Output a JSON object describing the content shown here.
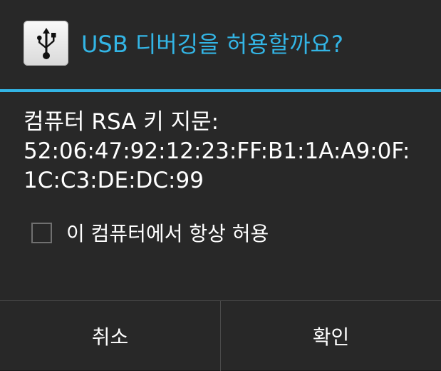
{
  "dialog": {
    "title": "USB 디버깅을 허용할까요?",
    "icon": "usb-icon",
    "accent_color": "#33b5e5",
    "message_line1": "컴퓨터 RSA 키 지문:",
    "message_line2": "52:06:47:92:12:23:FF:B1:1A:A9:0F:",
    "message_line3": "1C:C3:DE:DC:99",
    "checkbox_label": "이 컴퓨터에서 항상 허용",
    "checkbox_checked": false,
    "cancel_label": "취소",
    "ok_label": "확인"
  }
}
